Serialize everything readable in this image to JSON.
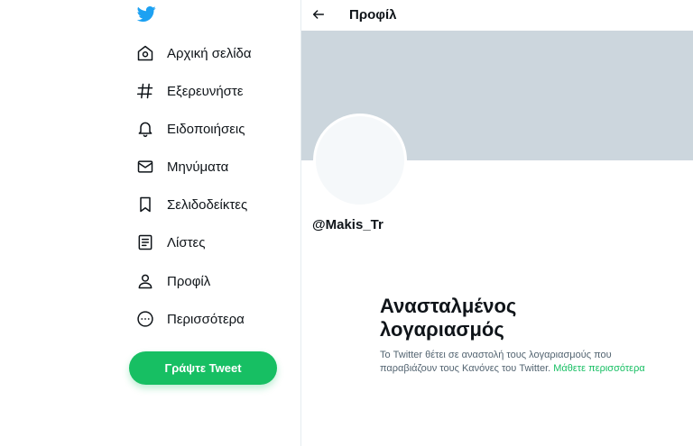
{
  "sidebar": {
    "logo": "twitter-bird-icon",
    "items": [
      {
        "label": "Αρχική σελίδα",
        "icon": "home-icon"
      },
      {
        "label": "Εξερευνήστε",
        "icon": "hashtag-icon"
      },
      {
        "label": "Ειδοποιήσεις",
        "icon": "bell-icon"
      },
      {
        "label": "Μηνύματα",
        "icon": "envelope-icon"
      },
      {
        "label": "Σελιδοδείκτες",
        "icon": "bookmark-icon"
      },
      {
        "label": "Λίστες",
        "icon": "list-icon"
      },
      {
        "label": "Προφίλ",
        "icon": "person-icon"
      },
      {
        "label": "Περισσότερα",
        "icon": "more-icon"
      }
    ],
    "tweet_button": "Γράψτε Tweet"
  },
  "header": {
    "title": "Προφίλ",
    "back_icon": "arrow-left-icon"
  },
  "profile": {
    "handle": "@Makis_Tr"
  },
  "suspended": {
    "title_line1": "Ανασταλμένος",
    "title_line2": "λογαριασμός",
    "description": "Το Twitter θέτει σε αναστολή τους λογαριασμούς που παραβιάζουν τους Κανόνες του Twitter.",
    "link": "Μάθετε περισσότερα"
  },
  "colors": {
    "accent": "#17bf63",
    "banner": "#ccd6dd",
    "text": "#0f1419",
    "secondary_text": "#536471"
  }
}
